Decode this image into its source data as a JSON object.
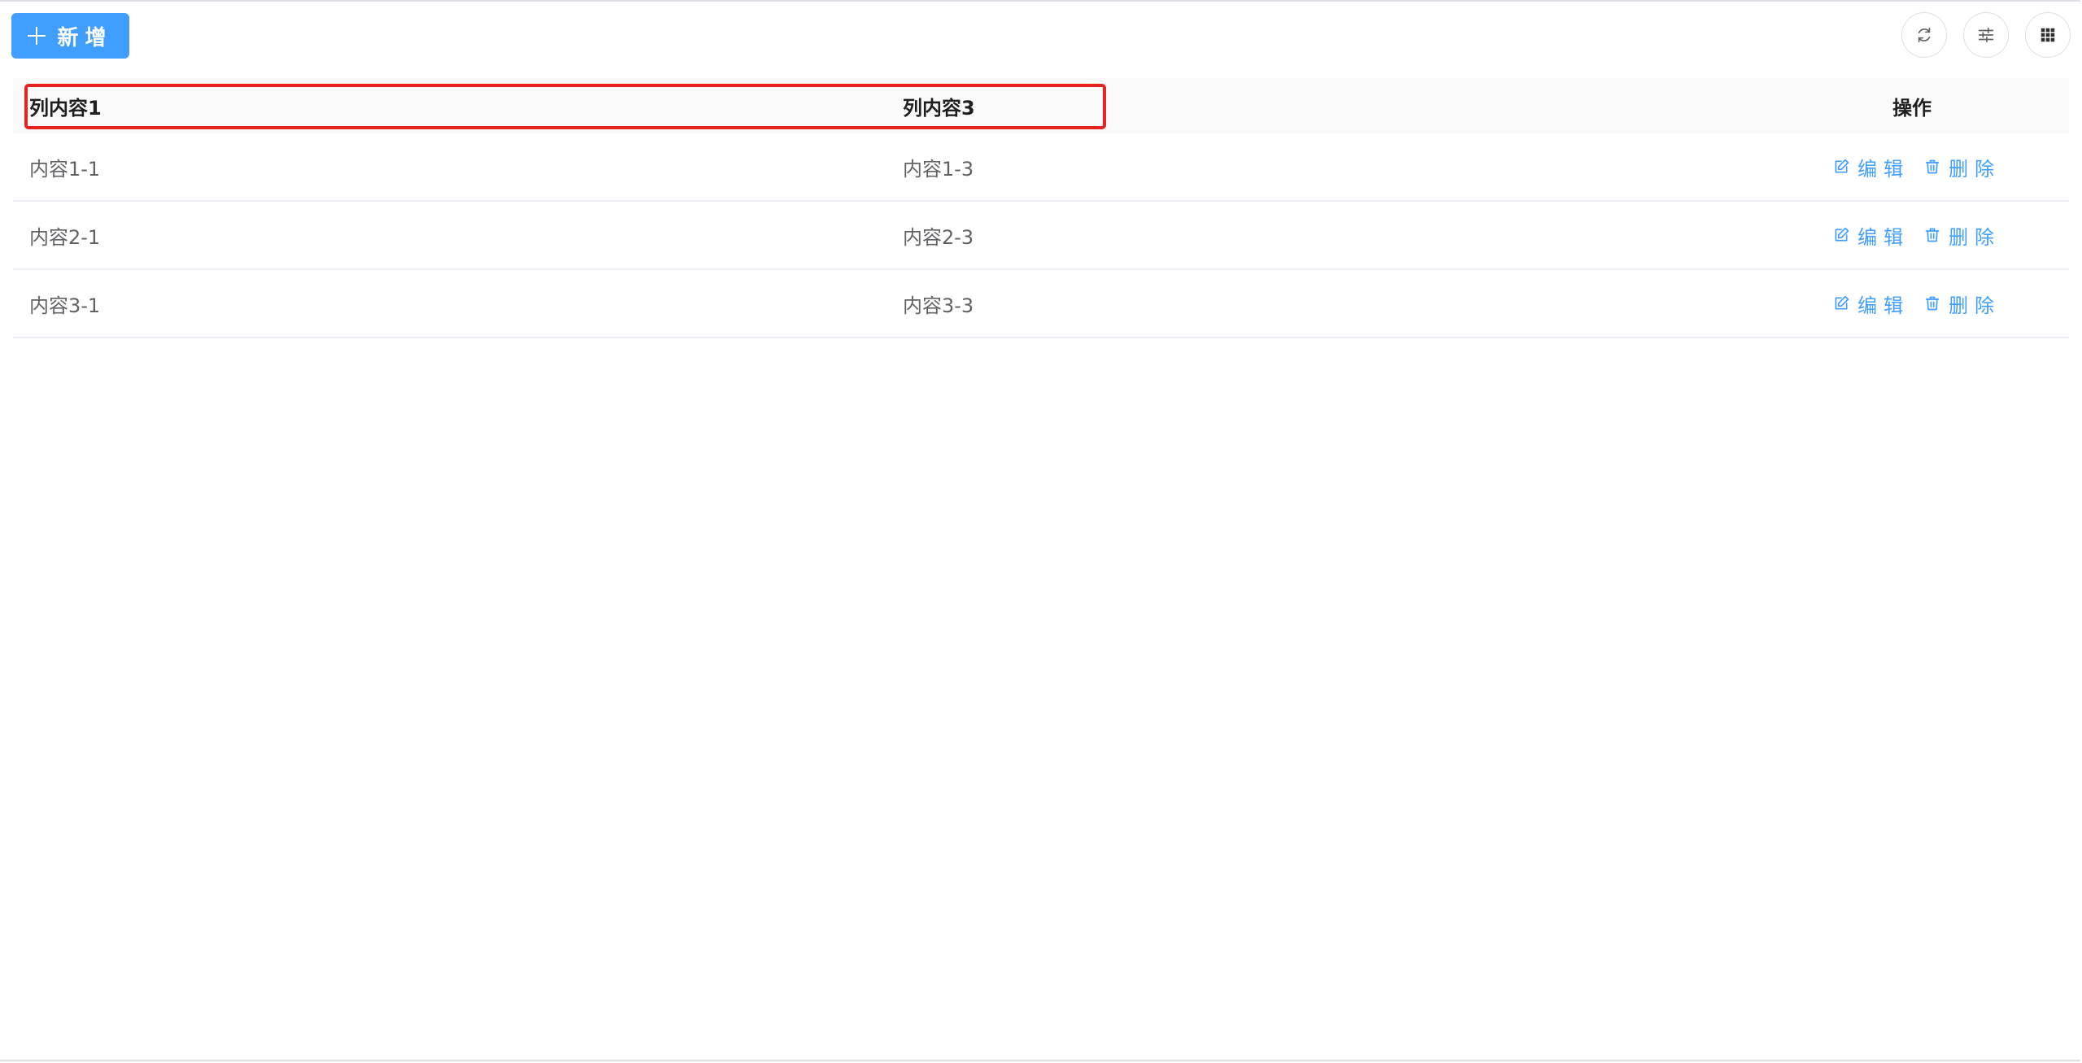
{
  "toolbar": {
    "add_label": "新增",
    "refresh_icon": "refresh-icon",
    "settings_icon": "sliders-icon",
    "columns_icon": "grid-icon"
  },
  "table": {
    "headers": {
      "col1": "列内容1",
      "col3": "列内容3",
      "operations": "操作"
    },
    "rows": [
      {
        "col1": "内容1-1",
        "col3": "内容1-3"
      },
      {
        "col1": "内容2-1",
        "col3": "内容2-3"
      },
      {
        "col1": "内容3-1",
        "col3": "内容3-3"
      }
    ],
    "actions": {
      "edit_label": "编辑",
      "delete_label": "删除"
    }
  },
  "colors": {
    "primary": "#409eff",
    "highlight": "#e8231f",
    "header_bg": "#fafafa"
  }
}
